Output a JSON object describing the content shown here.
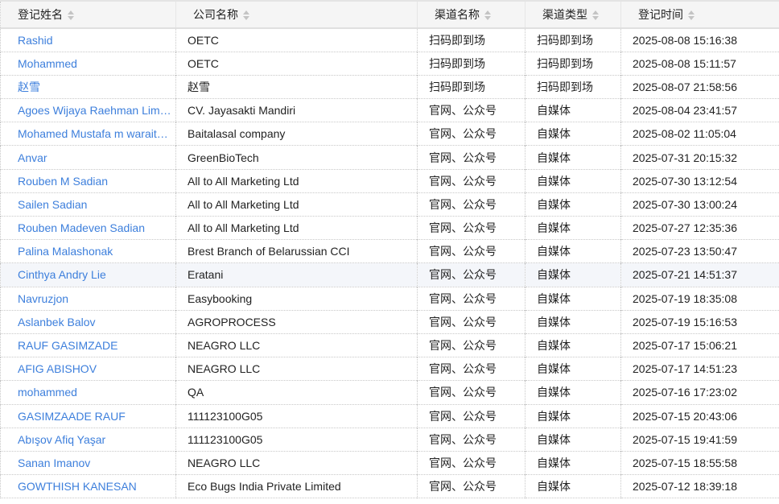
{
  "headers": [
    "登记姓名",
    "公司名称",
    "渠道名称",
    "渠道类型",
    "登记时间"
  ],
  "rows": [
    [
      "Rashid",
      "OETC",
      "扫码即到场",
      "扫码即到场",
      "2025-08-08 15:16:38"
    ],
    [
      "Mohammed",
      "OETC",
      "扫码即到场",
      "扫码即到场",
      "2025-08-08 15:11:57"
    ],
    [
      "赵雪",
      "赵雪",
      "扫码即到场",
      "扫码即到场",
      "2025-08-07 21:58:56"
    ],
    [
      "Agoes Wijaya Raehman Lim…",
      "CV. Jayasakti Mandiri",
      "官网、公众号",
      "自媒体",
      "2025-08-04 23:41:57"
    ],
    [
      "Mohamed Mustafa m warait…",
      "Baitalasal company",
      "官网、公众号",
      "自媒体",
      "2025-08-02 11:05:04"
    ],
    [
      "Anvar",
      "GreenBioTech",
      "官网、公众号",
      "自媒体",
      "2025-07-31 20:15:32"
    ],
    [
      "Rouben M Sadian",
      "All to All Marketing Ltd",
      "官网、公众号",
      "自媒体",
      "2025-07-30 13:12:54"
    ],
    [
      "Sailen Sadian",
      "All to All Marketing Ltd",
      "官网、公众号",
      "自媒体",
      "2025-07-30 13:00:24"
    ],
    [
      "Rouben Madeven Sadian",
      "All to All Marketing Ltd",
      "官网、公众号",
      "自媒体",
      "2025-07-27 12:35:36"
    ],
    [
      "Palina Malashonak",
      "Brest Branch of Belarussian CCI",
      "官网、公众号",
      "自媒体",
      "2025-07-23 13:50:47"
    ],
    [
      "Cinthya Andry Lie",
      "Eratani",
      "官网、公众号",
      "自媒体",
      "2025-07-21 14:51:37"
    ],
    [
      "Navruzjon",
      "Easybooking",
      "官网、公众号",
      "自媒体",
      "2025-07-19 18:35:08"
    ],
    [
      "Aslanbek Balov",
      "AGROPROCESS",
      "官网、公众号",
      "自媒体",
      "2025-07-19 15:16:53"
    ],
    [
      "RAUF GASIMZADE",
      "NEAGRO LLC",
      "官网、公众号",
      "自媒体",
      "2025-07-17 15:06:21"
    ],
    [
      "AFIG ABISHOV",
      "NEAGRO LLC",
      "官网、公众号",
      "自媒体",
      "2025-07-17 14:51:23"
    ],
    [
      "mohammed",
      "QA",
      "官网、公众号",
      "自媒体",
      "2025-07-16 17:23:02"
    ],
    [
      "GASIMZAADE RAUF",
      "111123100G05",
      "官网、公众号",
      "自媒体",
      "2025-07-15 20:43:06"
    ],
    [
      "Abışov Afiq Yaşar",
      "111123100G05",
      "官网、公众号",
      "自媒体",
      "2025-07-15 19:41:59"
    ],
    [
      "Sanan Imanov",
      "NEAGRO LLC",
      "官网、公众号",
      "自媒体",
      "2025-07-15 18:55:58"
    ],
    [
      "GOWTHISH KANESAN",
      "Eco Bugs India Private Limited",
      "官网、公众号",
      "自媒体",
      "2025-07-12 18:39:18"
    ]
  ],
  "hover_row": 10
}
